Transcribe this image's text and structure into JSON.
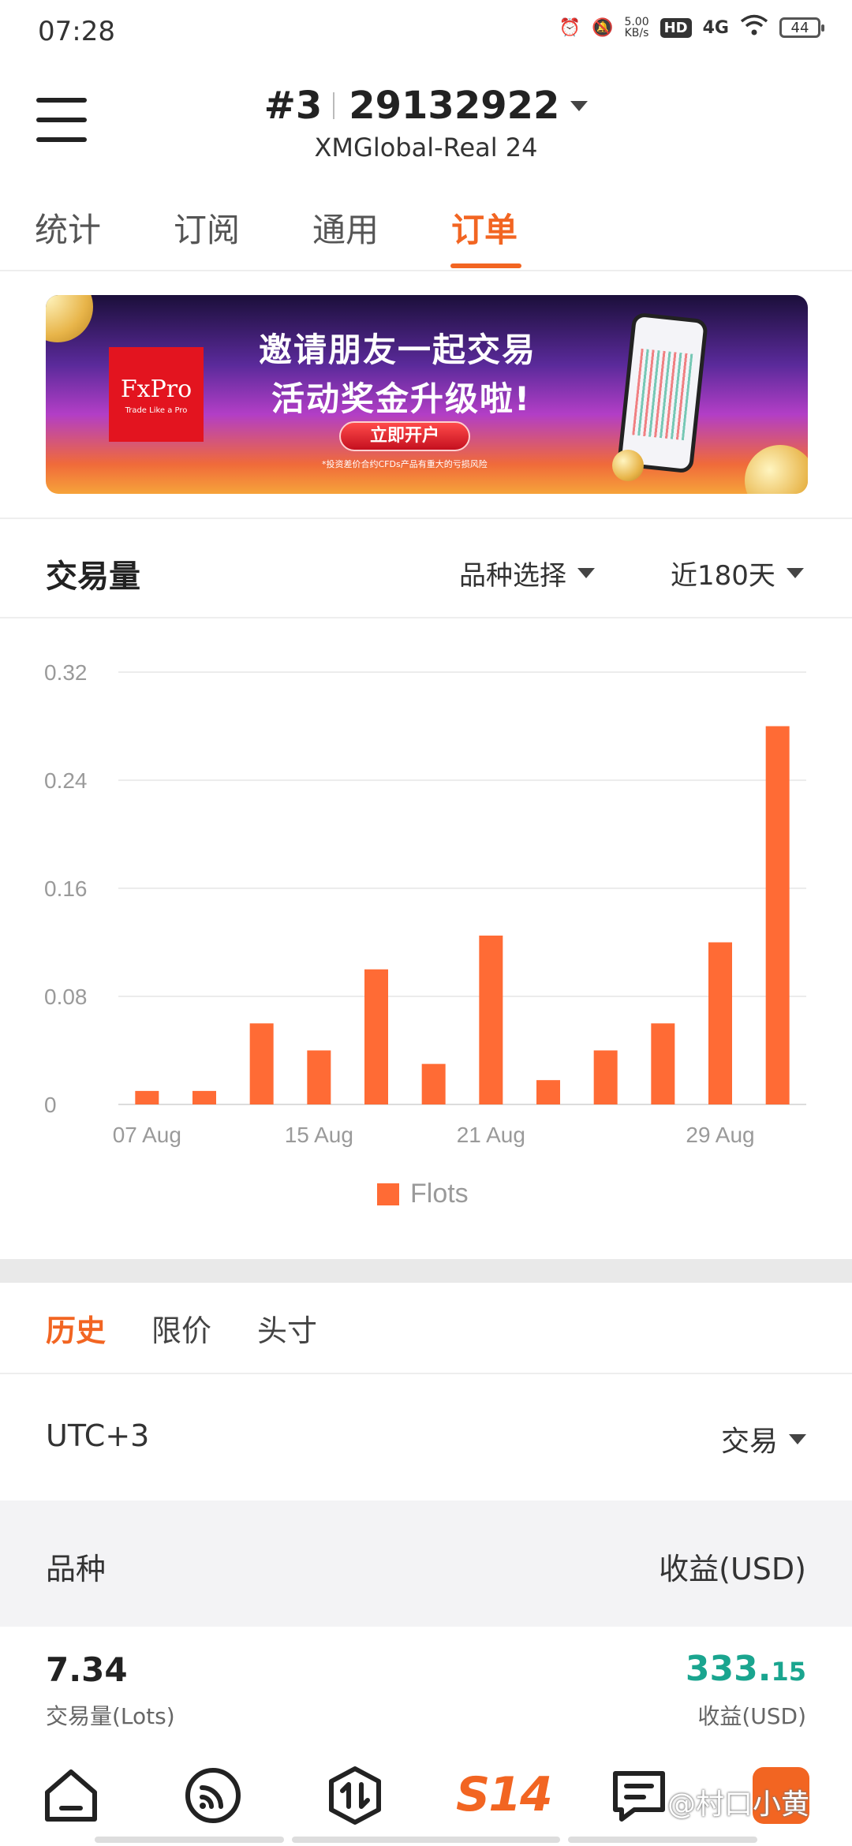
{
  "status_bar": {
    "time": "07:28",
    "net_speed": "5.00",
    "net_speed_unit": "KB/s",
    "hd": "HD",
    "network": "4G",
    "battery": "44"
  },
  "header": {
    "account_index": "#3",
    "account_number": "29132922",
    "server": "XMGlobal-Real 24"
  },
  "tabs": [
    {
      "label": "统计",
      "active": false
    },
    {
      "label": "订阅",
      "active": false
    },
    {
      "label": "通用",
      "active": false
    },
    {
      "label": "订单",
      "active": true
    }
  ],
  "banner": {
    "brand": "FxPro",
    "brand_tagline": "Trade Like a Pro",
    "line1": "邀请朋友一起交易",
    "line2": "活动奖金升级啦!",
    "cta": "立即开户",
    "note": "*投资差价合约CFDs产品有重大的亏损风险"
  },
  "volume": {
    "title": "交易量",
    "symbol_filter": "品种选择",
    "period_filter": "近180天"
  },
  "chart_data": {
    "type": "bar",
    "categories": [
      "07 Aug",
      "",
      "",
      "15 Aug",
      "",
      "",
      "21 Aug",
      "",
      "",
      "",
      "29 Aug",
      ""
    ],
    "x_tick_labels": [
      "07 Aug",
      "15 Aug",
      "21 Aug",
      "29 Aug"
    ],
    "series": [
      {
        "name": "Flots",
        "values": [
          0.01,
          0.01,
          0.06,
          0.04,
          0.1,
          0.03,
          0.125,
          0.018,
          0.04,
          0.06,
          0.12,
          0.28
        ]
      }
    ],
    "y_ticks": [
      "0",
      "0.08",
      "0.16",
      "0.24",
      "0.32"
    ],
    "ylim": [
      0,
      0.32
    ],
    "grid": true,
    "legend_position": "bottom",
    "color": "#ff6b35"
  },
  "history": {
    "tabs": [
      {
        "label": "历史",
        "active": true
      },
      {
        "label": "限价",
        "active": false
      },
      {
        "label": "头寸",
        "active": false
      }
    ],
    "timezone": "UTC+3",
    "type_filter": "交易",
    "col_symbol": "品种",
    "col_profit": "收益(USD)",
    "total_volume": "7.34",
    "total_volume_label": "交易量(Lots)",
    "total_profit_int": "333.",
    "total_profit_dec": "15",
    "total_profit_label": "收益(USD)",
    "profit_color": "#1aa58f"
  },
  "bottom_nav": {
    "items": [
      "home-icon",
      "signal-icon",
      "trade-icon",
      "brand-logo",
      "news-icon",
      "profile-icon"
    ],
    "brand_text": "S14",
    "watermark": "@村口小黄"
  },
  "accent_color": "#f26522"
}
